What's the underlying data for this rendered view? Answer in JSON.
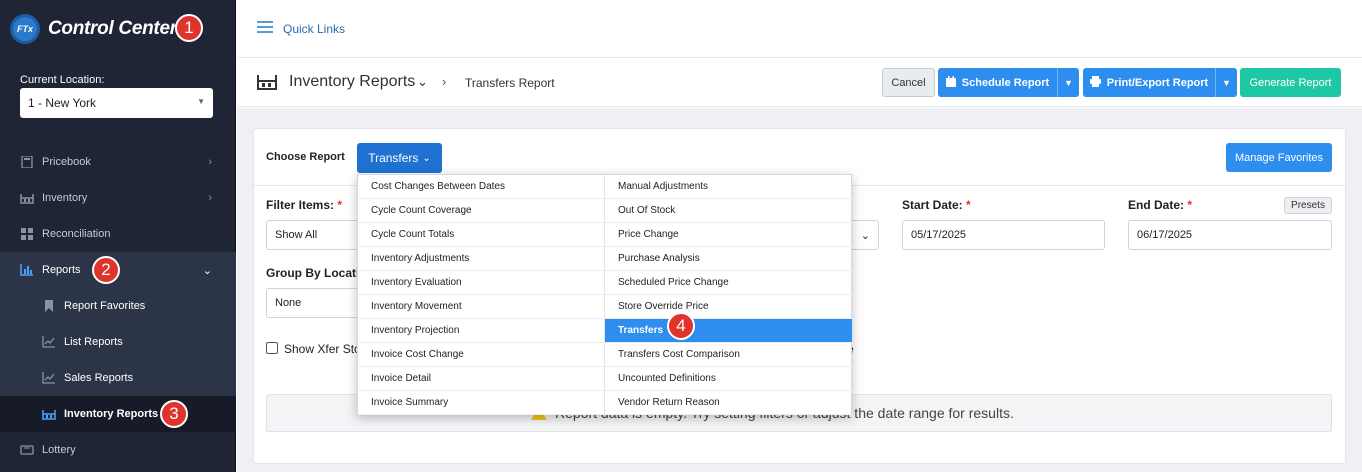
{
  "brand": {
    "logo_text": "FTx",
    "name": "Control Center"
  },
  "location": {
    "label": "Current Location:",
    "value": "1 - New York"
  },
  "sidebar": {
    "items": [
      {
        "label": "Pricebook",
        "icon": "calculator-icon"
      },
      {
        "label": "Inventory",
        "icon": "inventory-icon"
      },
      {
        "label": "Reconciliation",
        "icon": "grid-icon"
      },
      {
        "label": "Reports",
        "icon": "bar-chart-icon"
      },
      {
        "label": "Report Favorites",
        "icon": "bookmark-icon"
      },
      {
        "label": "List Reports",
        "icon": "line-chart-icon"
      },
      {
        "label": "Sales Reports",
        "icon": "line-chart-icon"
      },
      {
        "label": "Inventory Reports",
        "icon": "inventory-icon"
      },
      {
        "label": "Lottery",
        "icon": "ticket-icon"
      }
    ]
  },
  "badges": [
    "1",
    "2",
    "3",
    "4"
  ],
  "topbar": {
    "quick_links": "Quick Links"
  },
  "header": {
    "title": "Inventory Reports",
    "breadcrumb": "Transfers Report",
    "cancel": "Cancel",
    "schedule": "Schedule Report",
    "print": "Print/Export Report",
    "generate": "Generate Report"
  },
  "form": {
    "choose_report_label": "Choose Report",
    "choose_report_value": "Transfers",
    "manage_favorites": "Manage Favorites",
    "filter_items_label": "Filter Items:",
    "filter_items_value": "Show All",
    "start_date_label": "Start Date:",
    "start_date_value": "05/17/2025",
    "end_date_label": "End Date:",
    "end_date_value": "06/17/2025",
    "presets": "Presets",
    "group_by_label": "Group By Locati",
    "group_by_value": "None",
    "show_xfer_label": "Show Xfer Sto",
    "trailing_text": "e"
  },
  "alert": {
    "text": "Report data is empty. Try setting filters or adjust the date range for results."
  },
  "dropdown": {
    "left": [
      "Cost Changes Between Dates",
      "Cycle Count Coverage",
      "Cycle Count Totals",
      "Inventory Adjustments",
      "Inventory Evaluation",
      "Inventory Movement",
      "Inventory Projection",
      "Invoice Cost Change",
      "Invoice Detail",
      "Invoice Summary"
    ],
    "right": [
      "Manual Adjustments",
      "Out Of Stock",
      "Price Change",
      "Purchase Analysis",
      "Scheduled Price Change",
      "Store Override Price",
      "Transfers",
      "Transfers Cost Comparison",
      "Uncounted Definitions",
      "Vendor Return Reason"
    ],
    "selected": "Transfers"
  },
  "colors": {
    "sidebar_bg": "#1f2535",
    "primary": "#2d8ef0",
    "generate": "#1fc8a4",
    "badge": "#e0332c"
  }
}
